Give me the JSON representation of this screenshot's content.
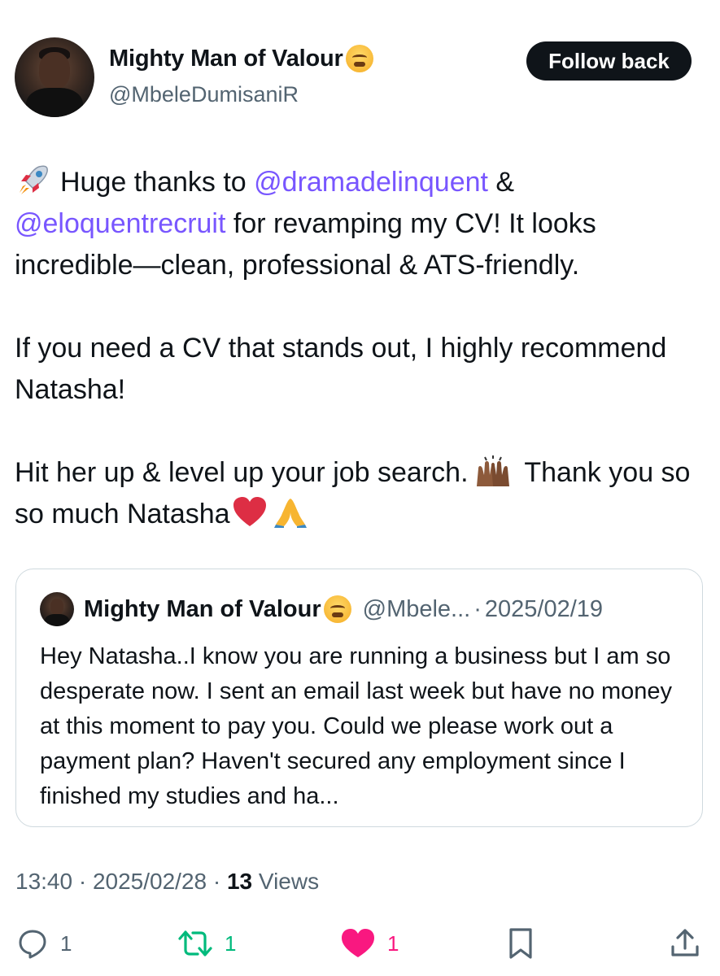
{
  "author": {
    "display_name": "Mighty Man of Valour",
    "handle": "@MbeleDumisaniR",
    "follow_label": "Follow back"
  },
  "tweet": {
    "line1_pre": "Huge thanks to ",
    "mention1": "@dramadelinquent",
    "line1_post": " &",
    "mention2": "@eloquentrecruit",
    "line2_post": " for revamping my CV! It looks incredible—clean, professional & ATS-friendly.",
    "para2": "If you need a CV that stands out, I highly recommend Natasha!",
    "para3_pre": "Hit her up & level up your job search.",
    "para3_post": " Thank you so so much Natasha"
  },
  "quoted": {
    "display_name": "Mighty Man of Valour",
    "handle": "@Mbele...",
    "separator": "·",
    "date": "2025/02/19",
    "text": "Hey Natasha..I know you are running a business but I am so desperate now. I sent an email last week but have no money at this moment to pay you. Could we please work out  a payment plan? Haven't secured any employment since I finished my studies and  ha..."
  },
  "meta": {
    "time_date": "13:40 · 2025/02/28 · ",
    "views_count": "13",
    "views_label": " Views"
  },
  "actions": {
    "replies": "1",
    "reposts": "1",
    "likes": "1"
  },
  "colors": {
    "mention": "#7856ff",
    "repost": "#00ba7c",
    "like": "#f91880",
    "secondary_text": "#536471"
  },
  "icons": [
    "rocket-icon",
    "raised-hands-icon",
    "red-heart-icon",
    "folded-hands-icon",
    "huffing-face-icon",
    "reply-icon",
    "repost-icon",
    "like-icon",
    "bookmark-icon",
    "share-icon"
  ]
}
